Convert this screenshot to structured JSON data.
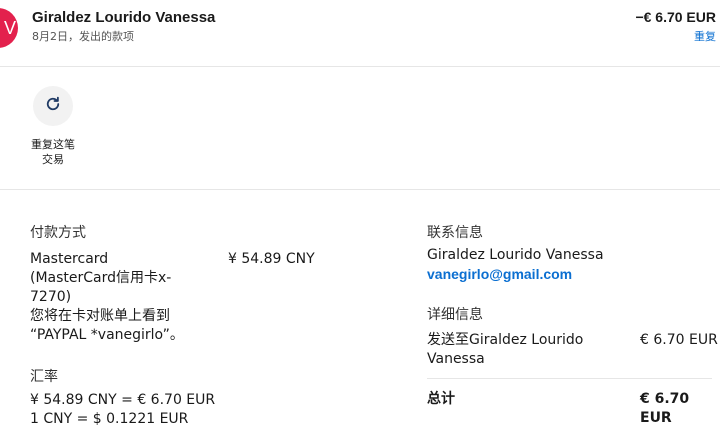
{
  "header": {
    "avatar_letter": "V",
    "name": "Giraldez Lourido Vanessa",
    "subtitle": "8月2日，发出的款项",
    "amount": "−€ 6.70 EUR",
    "repeat_link": "重复"
  },
  "action": {
    "repeat_label_line1": "重复这笔",
    "repeat_label_line2": "交易"
  },
  "payment": {
    "title": "付款方式",
    "lines": [
      "Mastercard",
      "(MasterCard信用卡x-",
      "7270)",
      "您将在卡对账单上看到",
      "“PAYPAL *vanegirlo”。"
    ],
    "amount": "¥ 54.89 CNY"
  },
  "exchange": {
    "title": "汇率",
    "line1": "¥ 54.89 CNY = € 6.70 EUR",
    "line2": "1 CNY = $ 0.1221 EUR"
  },
  "contact": {
    "title": "联系信息",
    "name": "Giraldez Lourido Vanessa",
    "email": "vanegirlo@gmail.com"
  },
  "details": {
    "title": "详细信息",
    "sent_to_line1": "发送至Giraldez Lourido",
    "sent_to_line2": "Vanessa",
    "sent_amount": "€ 6.70 EUR",
    "total_label": "总计",
    "total_amount": "€ 6.70 EUR"
  },
  "colors": {
    "avatar_bg": "#e3214d",
    "link": "#0b6fd1"
  },
  "icons": {
    "repeat": "refresh-icon"
  }
}
